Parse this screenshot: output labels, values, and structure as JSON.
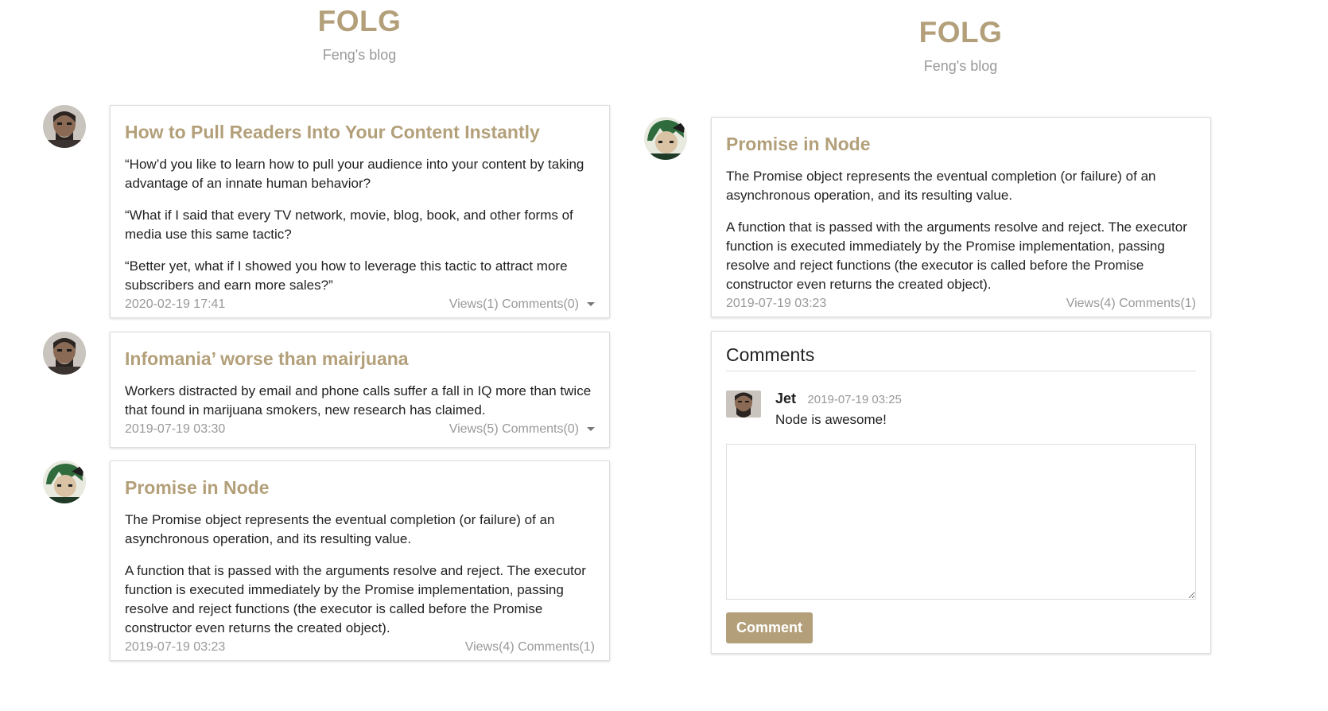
{
  "left": {
    "brand": {
      "logo": "FOLG",
      "subtitle": "Feng's blog"
    },
    "posts": [
      {
        "title": "How to Pull Readers Into Your Content Instantly",
        "paragraphs": [
          "“How’d you like to learn how to pull your audience into your content by taking advantage of an innate human behavior?",
          "“What if I said that every TV network, movie, blog, book, and other forms of media use this same tactic?",
          "“Better yet, what if I showed you how to leverage this tactic to attract more subscribers and earn more sales?”"
        ],
        "date": "2020-02-19 17:41",
        "stats": "Views(1) Comments(0)",
        "avatar": "avatar-bald-man"
      },
      {
        "title": "Infomania’ worse than mairjuana",
        "paragraphs": [
          "Workers distracted by email and phone calls suffer a fall in IQ more than twice that found in marijuana smokers, new research has claimed."
        ],
        "date": "2019-07-19 03:30",
        "stats": "Views(5) Comments(0)",
        "avatar": "avatar-bald-man"
      },
      {
        "title": "Promise in Node",
        "paragraphs": [
          "The Promise object represents the eventual completion (or failure) of an asynchronous operation, and its resulting value.",
          "A function that is passed with the arguments resolve and reject. The executor function is executed immediately by the Promise implementation, passing resolve and reject functions (the executor is called before the Promise constructor even returns the created object)."
        ],
        "date": "2019-07-19 03:23",
        "stats": "Views(4) Comments(1)",
        "avatar": "avatar-green-hair"
      }
    ]
  },
  "right": {
    "brand": {
      "logo": "FOLG",
      "subtitle": "Feng's blog"
    },
    "post": {
      "title": "Promise in Node",
      "paragraphs": [
        "The Promise object represents the eventual completion (or failure) of an asynchronous operation, and its resulting value.",
        "A function that is passed with the arguments resolve and reject. The executor function is executed immediately by the Promise implementation, passing resolve and reject functions (the executor is called before the Promise constructor even returns the created object)."
      ],
      "date": "2019-07-19 03:23",
      "stats": "Views(4) Comments(1)"
    },
    "comments": {
      "heading": "Comments",
      "items": [
        {
          "name": "Jet",
          "time": "2019-07-19 03:25",
          "text": "Node is awesome!"
        }
      ],
      "textarea_placeholder": "",
      "button_label": "Comment"
    }
  },
  "colors": {
    "accent": "#b3a07a",
    "muted": "#999999",
    "border": "#dddddd"
  }
}
